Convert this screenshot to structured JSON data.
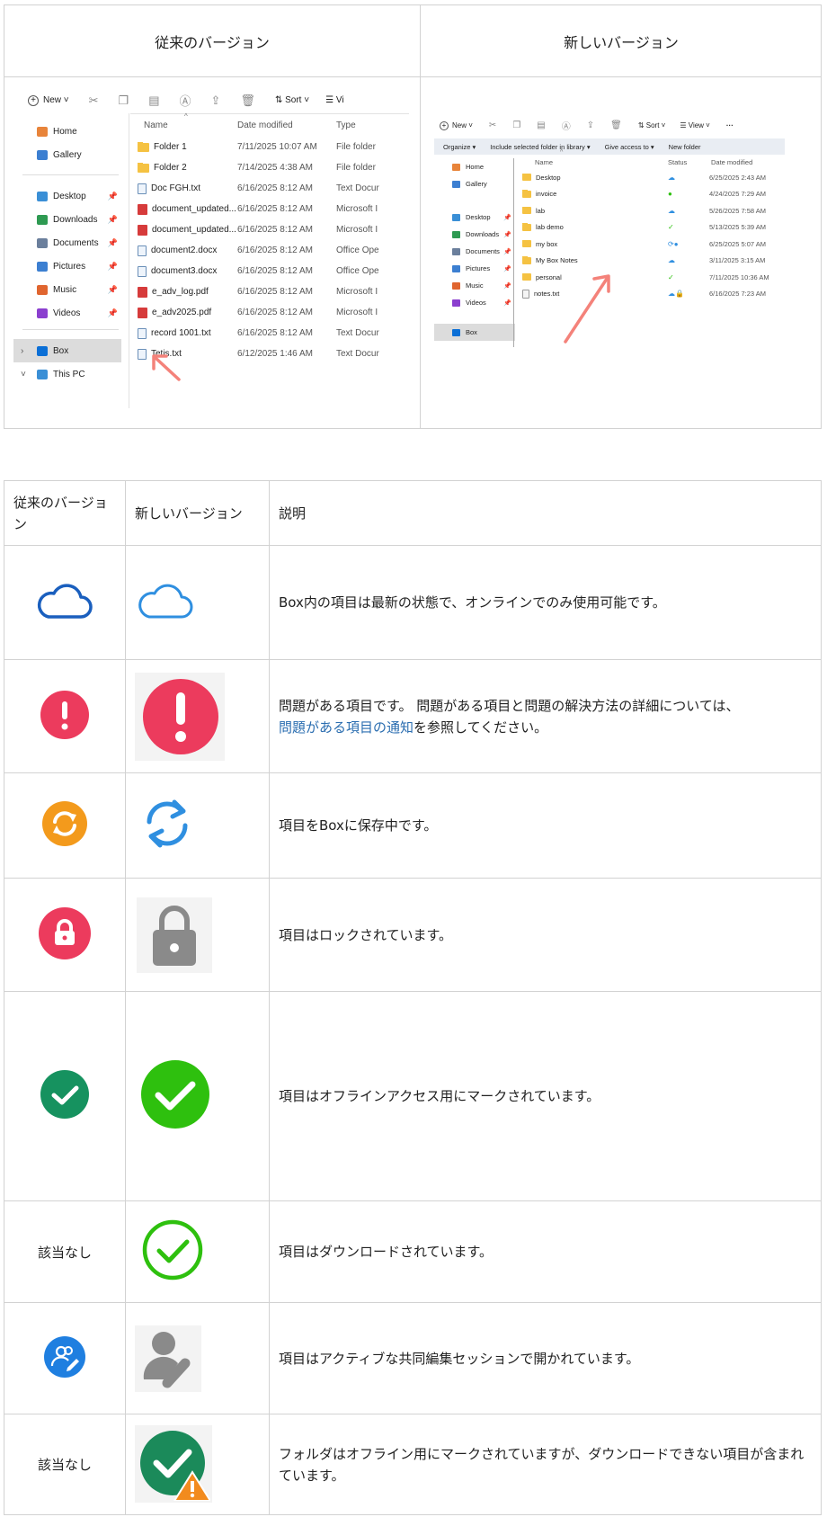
{
  "comparison": {
    "old_header": "従来のバージョン",
    "new_header": "新しいバージョン",
    "old_ui": {
      "toolbar": {
        "new": "New",
        "sort": "Sort",
        "view": "Vi"
      },
      "nav_items": [
        {
          "label": "Home",
          "icon": "home-icon",
          "pin": false
        },
        {
          "label": "Gallery",
          "icon": "gallery-icon",
          "pin": false
        },
        {
          "label": "Desktop",
          "icon": "desktop-icon",
          "pin": true
        },
        {
          "label": "Downloads",
          "icon": "download-icon",
          "pin": true
        },
        {
          "label": "Documents",
          "icon": "documents-icon",
          "pin": true
        },
        {
          "label": "Pictures",
          "icon": "pictures-icon",
          "pin": true
        },
        {
          "label": "Music",
          "icon": "music-icon",
          "pin": true
        },
        {
          "label": "Videos",
          "icon": "videos-icon",
          "pin": true
        },
        {
          "label": "Box",
          "icon": "box-icon",
          "pin": false
        },
        {
          "label": "This PC",
          "icon": "pc-icon",
          "pin": false
        }
      ],
      "columns": {
        "name": "Name",
        "date": "Date modified",
        "type": "Type"
      },
      "files": [
        {
          "name": "Folder 1",
          "date": "7/11/2025 10:07 AM",
          "type": "File folder",
          "kind": "folder"
        },
        {
          "name": "Folder 2",
          "date": "7/14/2025 4:38 AM",
          "type": "File folder",
          "kind": "folder"
        },
        {
          "name": "Doc FGH.txt",
          "date": "6/16/2025 8:12 AM",
          "type": "Text Docur",
          "kind": "doc"
        },
        {
          "name": "document_updated...",
          "date": "6/16/2025 8:12 AM",
          "type": "Microsoft I",
          "kind": "pdf"
        },
        {
          "name": "document_updated...",
          "date": "6/16/2025 8:12 AM",
          "type": "Microsoft I",
          "kind": "pdf"
        },
        {
          "name": "document2.docx",
          "date": "6/16/2025 8:12 AM",
          "type": "Office Ope",
          "kind": "doc"
        },
        {
          "name": "document3.docx",
          "date": "6/16/2025 8:12 AM",
          "type": "Office Ope",
          "kind": "doc"
        },
        {
          "name": "e_adv_log.pdf",
          "date": "6/16/2025 8:12 AM",
          "type": "Microsoft I",
          "kind": "pdf"
        },
        {
          "name": "e_adv2025.pdf",
          "date": "6/16/2025 8:12 AM",
          "type": "Microsoft I",
          "kind": "pdf"
        },
        {
          "name": "record 1001.txt",
          "date": "6/16/2025 8:12 AM",
          "type": "Text Docur",
          "kind": "doc"
        },
        {
          "name": "Tetis.txt",
          "date": "6/12/2025 1:46 AM",
          "type": "Text Docur",
          "kind": "doc"
        }
      ]
    },
    "new_ui": {
      "toolbar": {
        "new": "New",
        "sort": "Sort",
        "view": "View",
        "more": "···"
      },
      "commands": [
        "Organize ▾",
        "Include selected folder in library ▾",
        "Give access to ▾",
        "New folder"
      ],
      "nav_items": [
        {
          "label": "Home",
          "pin": false
        },
        {
          "label": "Gallery",
          "pin": false
        },
        {
          "label": "Desktop",
          "pin": true
        },
        {
          "label": "Downloads",
          "pin": true
        },
        {
          "label": "Documents",
          "pin": true
        },
        {
          "label": "Pictures",
          "pin": true
        },
        {
          "label": "Music",
          "pin": true
        },
        {
          "label": "Videos",
          "pin": true
        },
        {
          "label": "Box",
          "pin": false
        }
      ],
      "columns": {
        "name": "Name",
        "status": "Status",
        "date": "Date modified"
      },
      "files": [
        {
          "name": "Desktop",
          "date": "6/25/2025 2:43 AM",
          "status": "cloud",
          "kind": "folder"
        },
        {
          "name": "invoice",
          "date": "4/24/2025 7:29 AM",
          "status": "check-filled",
          "kind": "folder"
        },
        {
          "name": "lab",
          "date": "5/26/2025 7:58 AM",
          "status": "cloud",
          "kind": "folder"
        },
        {
          "name": "lab demo",
          "date": "5/13/2025 5:39 AM",
          "status": "check-outline",
          "kind": "folder"
        },
        {
          "name": "my box",
          "date": "6/25/2025 5:07 AM",
          "status": "sync",
          "kind": "folder"
        },
        {
          "name": "My Box Notes",
          "date": "3/11/2025 3:15 AM",
          "status": "cloud",
          "kind": "folder"
        },
        {
          "name": "personal",
          "date": "7/11/2025 10:36 AM",
          "status": "check-outline",
          "kind": "folder"
        },
        {
          "name": "notes.txt",
          "date": "6/16/2025 7:23 AM",
          "status": "cloud-lock",
          "kind": "doc"
        }
      ]
    }
  },
  "legend": {
    "headers": {
      "old": "従来のバージョン",
      "new": "新しいバージョン",
      "desc": "説明"
    },
    "rows": [
      {
        "old_icon": "cloud-icon",
        "new_icon": "cloud-icon",
        "old_text": "",
        "desc": "Box内の項目は最新の状態で、オンラインでのみ使用可能です。"
      },
      {
        "old_icon": "exclamation-icon",
        "new_icon": "exclamation-icon",
        "old_text": "",
        "desc": "問題がある項目です。 問題がある項目と問題の解決方法の詳細については、",
        "link": "問題がある項目の通知",
        "desc_after": "を参照してください。"
      },
      {
        "old_icon": "sync-icon",
        "new_icon": "sync-icon",
        "old_text": "",
        "desc": "項目をBoxに保存中です。"
      },
      {
        "old_icon": "lock-icon",
        "new_icon": "lock-icon",
        "old_text": "",
        "desc": "項目はロックされています。"
      },
      {
        "old_icon": "check-icon",
        "new_icon": "check-icon",
        "old_text": "",
        "desc": "項目はオフラインアクセス用にマークされています。"
      },
      {
        "old_icon": "",
        "new_icon": "check-outline-icon",
        "old_text": "該当なし",
        "desc": "項目はダウンロードされています。"
      },
      {
        "old_icon": "coedit-icon",
        "new_icon": "coedit-icon",
        "old_text": "",
        "desc": "項目はアクティブな共同編集セッションで開かれています。"
      },
      {
        "old_icon": "",
        "new_icon": "check-warning-icon",
        "old_text": "該当なし",
        "desc": "フォルダはオフライン用にマークされていますが、ダウンロードできない項目が含まれています。"
      }
    ]
  },
  "colors": {
    "cloud_old": "#1a5fbe",
    "cloud_new": "#2f8fe0",
    "alert": "#ec3b5d",
    "sync_old": "#f39a1c",
    "sync_new": "#2f8fe0",
    "lock_old": "#ec3b5d",
    "lock_new": "#8a8a8a",
    "check_old": "#16925f",
    "check_new": "#2ec00e",
    "coedit_old": "#1f7fe0",
    "link": "#2a6db0"
  }
}
